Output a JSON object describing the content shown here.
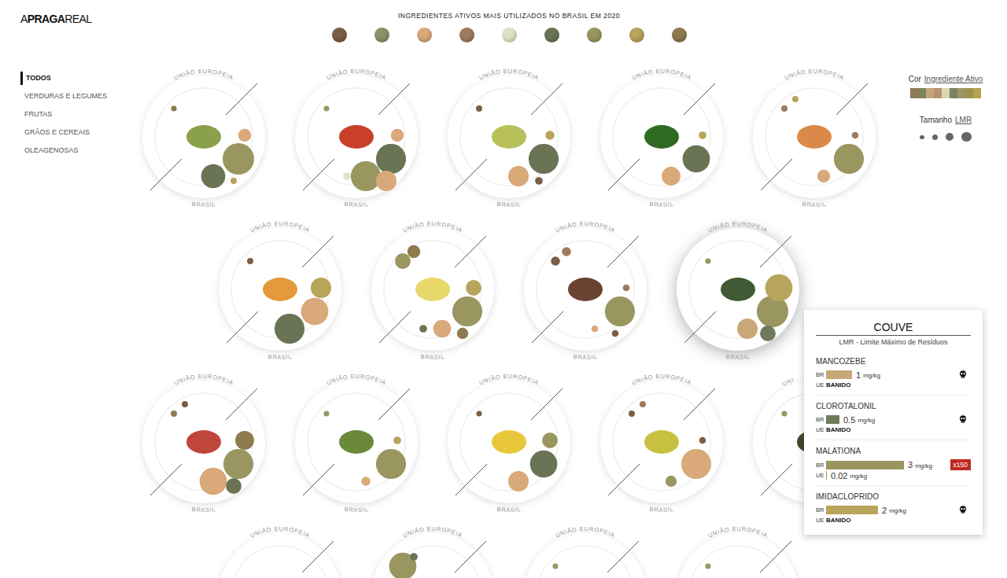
{
  "logo": {
    "parts": [
      {
        "text": "A",
        "bold": false
      },
      {
        "text": "PRAGA",
        "bold": true
      },
      {
        "text": "REAL",
        "bold": false
      }
    ]
  },
  "header": {
    "title": "INGREDIENTES ATIVOS MAIS UTILIZADOS NO BRASIL EM 2020",
    "ingredients": [
      {
        "color": "#7a5f45"
      },
      {
        "color": "#8a9468"
      },
      {
        "color": "#d9a97a"
      },
      {
        "color": "#9e7b5e"
      },
      {
        "color": "#dfe3c4"
      },
      {
        "color": "#6a7455"
      },
      {
        "color": "#9a9660"
      },
      {
        "color": "#b8a45a"
      },
      {
        "color": "#8e7a4c"
      }
    ]
  },
  "sidebar": {
    "items": [
      {
        "label": "TODOS",
        "selected": true
      },
      {
        "label": "VERDURAS E LEGUMES",
        "selected": false
      },
      {
        "label": "FRUTAS",
        "selected": false
      },
      {
        "label": "GRÃOS E CEREAIS",
        "selected": false
      },
      {
        "label": "OLEAGENOSAS",
        "selected": false
      }
    ]
  },
  "legend": {
    "cor_label": "Cor",
    "cor_link": "Ingrediente Ativo",
    "color_strip": [
      "#8f7a56",
      "#7c8458",
      "#c8a27a",
      "#b89070",
      "#d8d8b0",
      "#7a8260",
      "#9a9660",
      "#a09050",
      "#b8a050"
    ],
    "size_label": "Tamanho",
    "size_link": "LMR",
    "size_steps": [
      0.05,
      0.3,
      1,
      2
    ]
  },
  "plate_rows": [
    [
      {
        "eu_label": "UNIÃO EUROPEIA",
        "eu_label_cut": false,
        "br_label": "BRASIL",
        "color": "#8aa04a",
        "highlighted": false,
        "eu": [
          {
            "color": "#8e7a4c",
            "lmr": 0.01
          }
        ],
        "br": [
          {
            "color": "#9a9660",
            "lmr": 3
          },
          {
            "color": "#6a7455",
            "lmr": 1.5
          },
          {
            "color": "#d9a97a",
            "lmr": 0.3
          },
          {
            "color": "#b8a45a",
            "lmr": 0.02
          }
        ]
      },
      {
        "eu_label": "UNIÃO EUROPEIA",
        "eu_label_cut": false,
        "br_label": "BRASIL",
        "color": "#c8402a",
        "highlighted": false,
        "eu": [
          {
            "color": "#9a9660",
            "lmr": 0.01
          }
        ],
        "br": [
          {
            "color": "#6a7455",
            "lmr": 2.5
          },
          {
            "color": "#9a9660",
            "lmr": 2.5
          },
          {
            "color": "#d9a97a",
            "lmr": 0.3
          },
          {
            "color": "#d9a97a",
            "lmr": 1
          },
          {
            "color": "#dfe3c4",
            "lmr": 0.05
          }
        ]
      },
      {
        "eu_label": "UNIÃO EUROPEIA",
        "eu_label_cut": false,
        "br_label": "BRASIL",
        "color": "#b7c05a",
        "highlighted": false,
        "eu": [
          {
            "color": "#7a5f45",
            "lmr": 0.02
          }
        ],
        "br": [
          {
            "color": "#6a7455",
            "lmr": 2.5
          },
          {
            "color": "#d9a97a",
            "lmr": 1
          },
          {
            "color": "#b8a45a",
            "lmr": 0.1
          },
          {
            "color": "#7a5f45",
            "lmr": 0.05
          }
        ]
      },
      {
        "eu_label": "UNIÃO EUROPEIA",
        "eu_label_cut": false,
        "br_label": "BRASIL",
        "color": "#2f6a22",
        "highlighted": false,
        "eu": [],
        "br": [
          {
            "color": "#6a7455",
            "lmr": 2
          },
          {
            "color": "#d9a97a",
            "lmr": 0.8
          },
          {
            "color": "#b8a45a",
            "lmr": 0.05
          }
        ]
      },
      {
        "eu_label": "UNIÃO EUROPEIA",
        "eu_label_cut": false,
        "br_label": "BRASIL",
        "color": "#d98a4a",
        "highlighted": false,
        "eu": [
          {
            "color": "#9e7b5e",
            "lmr": 0.02
          },
          {
            "color": "#b8a45a",
            "lmr": 0.02
          }
        ],
        "br": [
          {
            "color": "#9a9660",
            "lmr": 2.5
          },
          {
            "color": "#d9a97a",
            "lmr": 0.3
          },
          {
            "color": "#9e7b5e",
            "lmr": 0.03
          }
        ]
      }
    ],
    [
      {
        "eu_label": "UNIÃO EUROPEIA",
        "eu_label_cut": false,
        "br_label": "BRASIL",
        "color": "#e39a3a",
        "highlighted": false,
        "eu": [
          {
            "color": "#7a5f45",
            "lmr": 0.02
          }
        ],
        "br": [
          {
            "color": "#d9a97a",
            "lmr": 2
          },
          {
            "color": "#6a7455",
            "lmr": 2.5
          },
          {
            "color": "#b8a45a",
            "lmr": 1
          }
        ]
      },
      {
        "eu_label": "UNIÃO EUROPEIA",
        "eu_label_cut": false,
        "br_label": "BRASIL",
        "color": "#e8d86a",
        "highlighted": false,
        "eu": [
          {
            "color": "#9a9660",
            "lmr": 0.5
          },
          {
            "color": "#8e7a4c",
            "lmr": 0.3
          }
        ],
        "br": [
          {
            "color": "#9a9660",
            "lmr": 2.5
          },
          {
            "color": "#d9a97a",
            "lmr": 0.7
          },
          {
            "color": "#b8a45a",
            "lmr": 0.5
          },
          {
            "color": "#8e7a4c",
            "lmr": 0.2
          },
          {
            "color": "#6a7455",
            "lmr": 0.05
          }
        ]
      },
      {
        "eu_label": "UNIÃO EUROPEIA",
        "eu_label_cut": false,
        "br_label": "BRASIL",
        "color": "#6b4130",
        "highlighted": false,
        "eu": [
          {
            "color": "#7a5f45",
            "lmr": 0.1
          },
          {
            "color": "#9e7b5e",
            "lmr": 0.1
          }
        ],
        "br": [
          {
            "color": "#9a9660",
            "lmr": 2.5
          },
          {
            "color": "#d9a97a",
            "lmr": 0.03
          },
          {
            "color": "#9e7b5e",
            "lmr": 0.03
          },
          {
            "color": "#7a5f45",
            "lmr": 0.03
          }
        ]
      },
      {
        "eu_label": "UNIÃO EUROPEIA",
        "eu_label_cut": false,
        "br_label": "BRASIL",
        "color": "#3f5a34",
        "highlighted": true,
        "eu": [
          {
            "color": "#9a9660",
            "lmr": 0.01
          }
        ],
        "br": [
          {
            "color": "#9a9660",
            "lmr": 3
          },
          {
            "color": "#c9a878",
            "lmr": 1
          },
          {
            "color": "#b8a45a",
            "lmr": 2
          },
          {
            "color": "#6f7a5a",
            "lmr": 0.5
          }
        ]
      }
    ],
    [
      {
        "eu_label": "UNIÃO EUROPEIA",
        "eu_label_cut": false,
        "br_label": "BRASIL",
        "color": "#c0453a",
        "highlighted": false,
        "eu": [
          {
            "color": "#8e7a4c",
            "lmr": 0.02
          },
          {
            "color": "#7a5f45",
            "lmr": 0.02
          }
        ],
        "br": [
          {
            "color": "#9a9660",
            "lmr": 2.5
          },
          {
            "color": "#d9a97a",
            "lmr": 2
          },
          {
            "color": "#8e7a4c",
            "lmr": 0.8
          },
          {
            "color": "#6a7455",
            "lmr": 0.5
          }
        ]
      },
      {
        "eu_label": "UNIÃO EUROPEIA",
        "eu_label_cut": false,
        "br_label": "BRASIL",
        "color": "#6a8a3a",
        "highlighted": false,
        "eu": [
          {
            "color": "#9a9660",
            "lmr": 0.01
          }
        ],
        "br": [
          {
            "color": "#9a9660",
            "lmr": 2.5
          },
          {
            "color": "#d9a97a",
            "lmr": 0.1
          },
          {
            "color": "#b8a45a",
            "lmr": 0.05
          }
        ]
      },
      {
        "eu_label": "UNIÃO EUROPEIA",
        "eu_label_cut": false,
        "br_label": "BRASIL",
        "color": "#e8c83a",
        "highlighted": false,
        "eu": [
          {
            "color": "#7a5f45",
            "lmr": 0.01
          }
        ],
        "br": [
          {
            "color": "#6a7455",
            "lmr": 2
          },
          {
            "color": "#d9a97a",
            "lmr": 1
          },
          {
            "color": "#9a9660",
            "lmr": 0.5
          }
        ]
      },
      {
        "eu_label": "UNIÃO EUROPEIA",
        "eu_label_cut": false,
        "br_label": "BRASIL",
        "color": "#c8c040",
        "highlighted": false,
        "eu": [
          {
            "color": "#7a5f45",
            "lmr": 0.02
          },
          {
            "color": "#9e7b5e",
            "lmr": 0.02
          }
        ],
        "br": [
          {
            "color": "#d9a97a",
            "lmr": 2.5
          },
          {
            "color": "#9a9660",
            "lmr": 0.2
          },
          {
            "color": "#7a5f45",
            "lmr": 0.03
          }
        ]
      },
      {
        "eu_label": "UNI",
        "eu_label_cut": true,
        "br_label": "",
        "color": "#3f4a2a",
        "highlighted": false,
        "eu": [
          {
            "color": "#9a9660",
            "lmr": 0.01
          }
        ],
        "br": []
      }
    ],
    [
      {
        "eu_label": "UNIÃO EUROPEIA",
        "eu_label_cut": false,
        "br_label": "",
        "color": "#d9c9a0",
        "highlighted": false,
        "eu": [],
        "br": []
      },
      {
        "eu_label": "UNIÃO EUROPEIA",
        "eu_label_cut": false,
        "br_label": "",
        "color": "#b0a080",
        "highlighted": false,
        "eu": [
          {
            "color": "#9a9660",
            "lmr": 2
          },
          {
            "color": "#6a7455",
            "lmr": 0.05
          }
        ],
        "br": []
      },
      {
        "eu_label": "UNIÃO EUROPEIA",
        "eu_label_cut": false,
        "br_label": "",
        "color": "#c0a070",
        "highlighted": false,
        "eu": [
          {
            "color": "#9a9660",
            "lmr": 0.01
          }
        ],
        "br": []
      },
      {
        "eu_label": "UNIÃO EUROPEIA",
        "eu_label_cut": false,
        "br_label": "",
        "color": "#a0a070",
        "highlighted": false,
        "eu": [
          {
            "color": "#9a9660",
            "lmr": 0.01
          }
        ],
        "br": []
      }
    ]
  ],
  "tooltip": {
    "title": "COUVE",
    "subtitle": "LMR - Limite Máximo de Resíduos",
    "br_label": "BR",
    "ue_label": "UE",
    "items": [
      {
        "name": "MANCOZEBE",
        "br": {
          "value": "1",
          "unit": "mg/kg",
          "level": 0.333,
          "color": "#c9a878"
        },
        "ue": {
          "kind": "banned",
          "text": "BANIDO"
        },
        "marker": {
          "kind": "skull"
        }
      },
      {
        "name": "CLOROTALONIL",
        "br": {
          "value": "0.5",
          "unit": "mg/kg",
          "level": 0.167,
          "color": "#6f7a5a"
        },
        "ue": {
          "kind": "banned",
          "text": "BANIDO"
        },
        "marker": {
          "kind": "skull"
        }
      },
      {
        "name": "MALATIONA",
        "br": {
          "value": "3",
          "unit": "mg/kg",
          "level": 1,
          "color": "#9a9660"
        },
        "ue": {
          "kind": "limit",
          "value": "0.02",
          "unit": "mg/kg",
          "level": 0.007,
          "color": "#9a9660"
        },
        "marker": {
          "kind": "badge",
          "text": "x150"
        }
      },
      {
        "name": "IMIDACLOPRIDO",
        "br": {
          "value": "2",
          "unit": "mg/kg",
          "level": 0.667,
          "color": "#b8a45a"
        },
        "ue": {
          "kind": "banned",
          "text": "BANIDO"
        },
        "marker": {
          "kind": "skull"
        }
      }
    ]
  }
}
